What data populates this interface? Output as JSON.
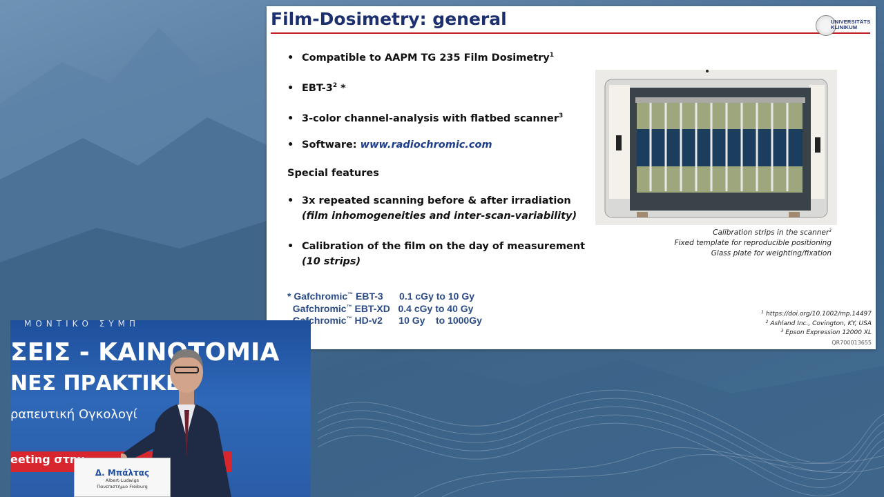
{
  "slide": {
    "title": "Film-Dosimetry: general",
    "logo_text_1": "UNIVERSITÄTS",
    "logo_text_2": "KLINIKUM",
    "bullets": {
      "b1_text": "Compatible to AAPM TG 235 Film Dosimetry",
      "b1_sup": "1",
      "b2_text": "EBT-3",
      "b2_sup": "2",
      "b2_tail": " *",
      "b3_text": "3-color channel-analysis with flatbed scanner",
      "b3_sup": "3",
      "b4_label": "Software: ",
      "b4_link": "www.radiochromic.com"
    },
    "special_heading": "Special features",
    "special": {
      "s1_text": "3x repeated scanning before & after irradiation",
      "s1_sub": "(film inhomogeneities and inter-scan-variability)",
      "s2_text": "Calibration of the film on the day of measurement",
      "s2_sub": "(10 strips)"
    },
    "gafchromic": [
      {
        "prefix": "* Gafchromic",
        "tm": "™",
        "name": " EBT-3      0.1 cGy to 10 Gy"
      },
      {
        "prefix": "  Gafchromic",
        "tm": "™",
        "name": " EBT-XD   0.4 cGy to 40 Gy"
      },
      {
        "prefix": "  Gafchromic",
        "tm": "™",
        "name": " HD-v2      10 Gy    to 1000Gy"
      }
    ],
    "caption": {
      "line1": "Calibration strips in the scanner",
      "line1_sup": "3",
      "line2": "Fixed template for reproducible positioning",
      "line3": "Glass plate for weighting/fixation"
    },
    "refs": {
      "r1_sup": "1",
      "r1": " https://doi.org/10.1002/mp.14497",
      "r2_sup": "2",
      "r2": " Ashland Inc., Covington, KY, USA",
      "r3_sup": "3",
      "r3": " Epson Expression 12000 XL",
      "code": "QR700013655"
    }
  },
  "video": {
    "banner_top": "ΜΟΝΤΙΚΟ ΣΥΜΠ",
    "banner_line1": "ΣΕΙΣ - ΚΑΙΝΟΤΟΜΙΑ",
    "banner_line2": "ΝΕΣ ΠΡΑΚΤΙΚΕ",
    "banner_line3": "ραπευτική Ογκολογί",
    "banner_line4": "eeting στην",
    "podium_name": "Δ. Μπάλτας",
    "podium_sub1": "Albert-Ludwigs",
    "podium_sub2": "Πανεπιστήμιο Freiburg"
  },
  "colors": {
    "title": "#1c2f6e",
    "rule": "#c01a1a",
    "link": "#1c3d8a",
    "gafchromic": "#2b4b86",
    "stage_blue": "#1d4f9c",
    "stage_red": "#d8262e"
  }
}
